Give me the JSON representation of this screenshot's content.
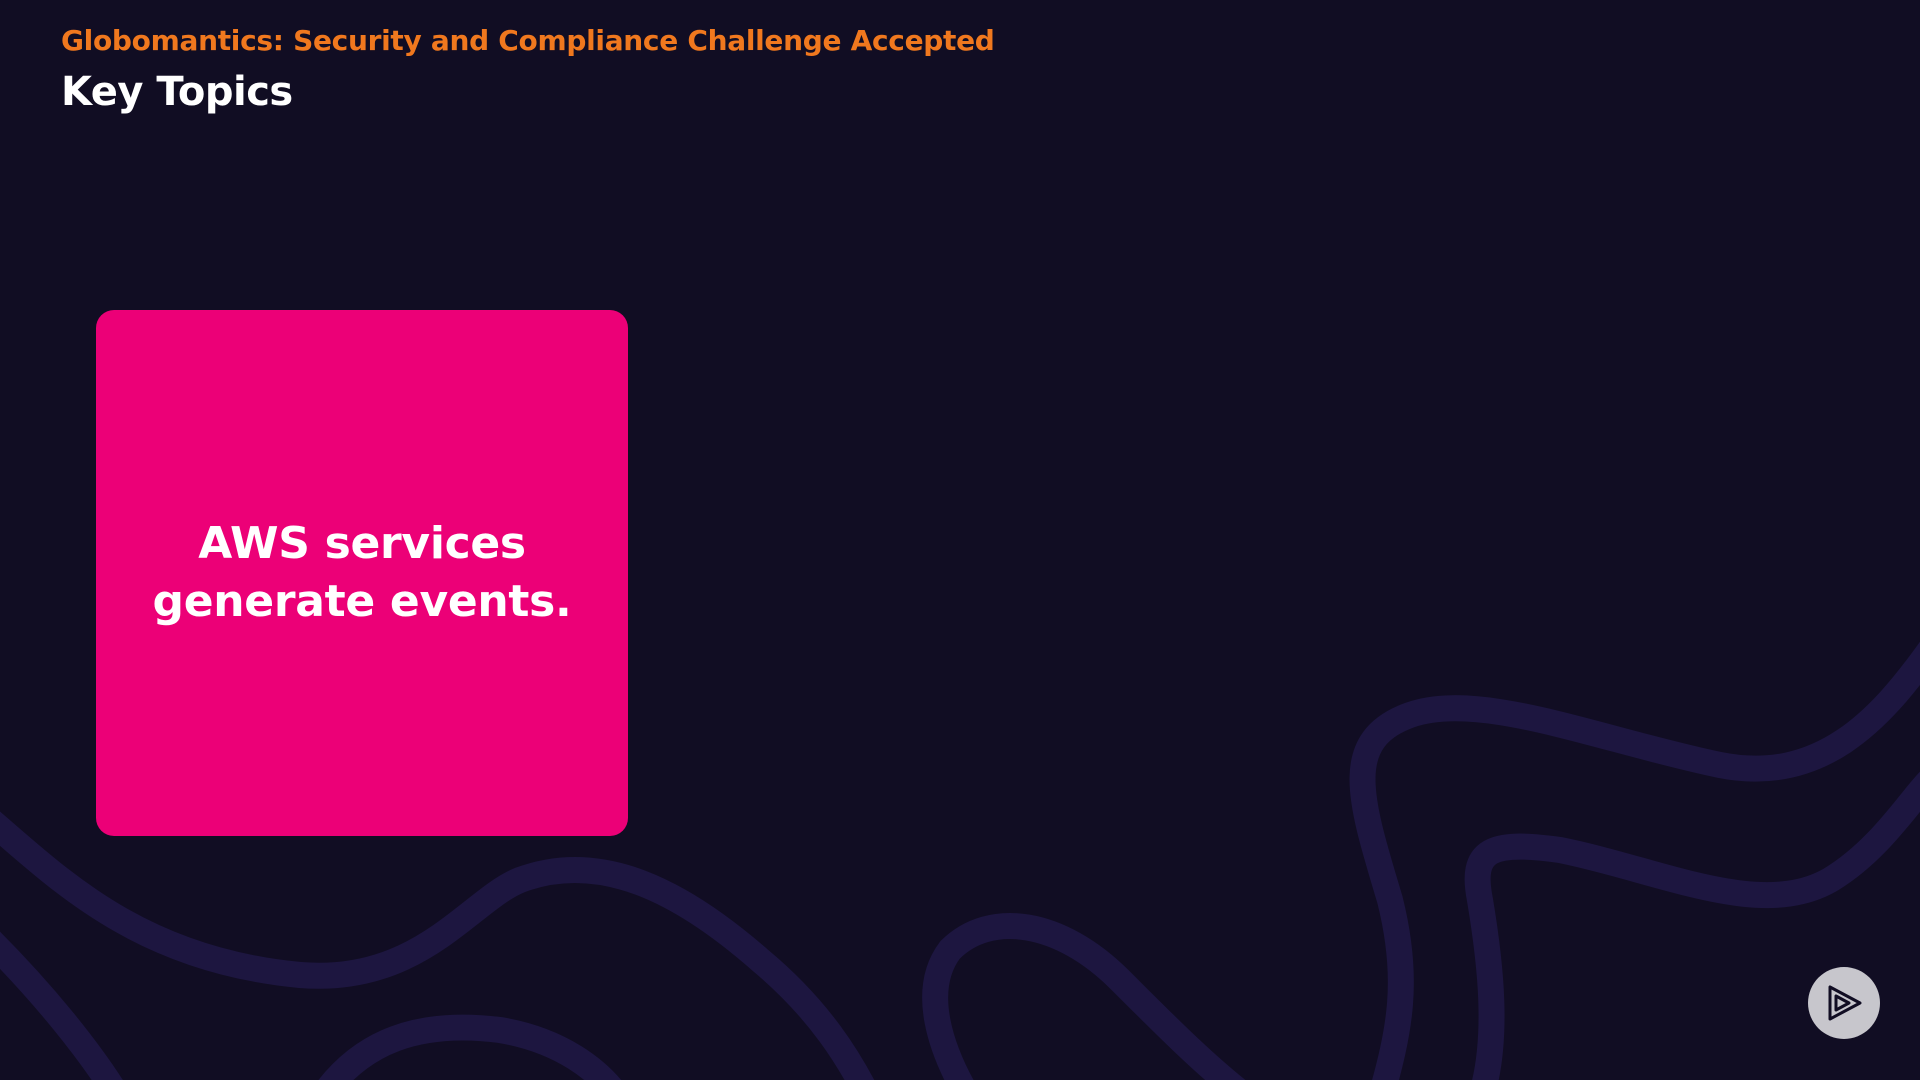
{
  "header": {
    "course_title": "Globomantics: Security and Compliance Challenge Accepted",
    "section_title": "Key Topics"
  },
  "topic_card": {
    "text": "AWS services generate events."
  },
  "controls": {
    "play_icon": "play-logo-icon"
  },
  "colors": {
    "background": "#110d23",
    "accent_orange": "#f0781e",
    "card_pink": "#ec0077",
    "swirl": "#1d1640",
    "play_button_bg": "#c7c6cc"
  }
}
